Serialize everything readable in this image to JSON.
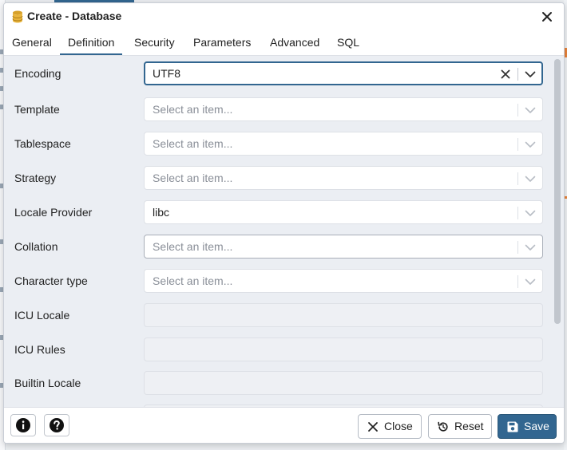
{
  "dialog": {
    "title": "Create - Database",
    "close_icon": "close-icon",
    "title_icon": "database-icon"
  },
  "tabs": [
    {
      "label": "General"
    },
    {
      "label": "Definition",
      "active": true
    },
    {
      "label": "Security"
    },
    {
      "label": "Parameters"
    },
    {
      "label": "Advanced"
    },
    {
      "label": "SQL"
    }
  ],
  "fields": {
    "encoding": {
      "label": "Encoding",
      "value": "UTF8"
    },
    "template": {
      "label": "Template",
      "placeholder": "Select an item..."
    },
    "tablespace": {
      "label": "Tablespace",
      "placeholder": "Select an item..."
    },
    "strategy": {
      "label": "Strategy",
      "placeholder": "Select an item..."
    },
    "locale_provider": {
      "label": "Locale Provider",
      "value": "libc"
    },
    "collation": {
      "label": "Collation",
      "placeholder": "Select an item..."
    },
    "character_type": {
      "label": "Character type",
      "placeholder": "Select an item..."
    },
    "icu_locale": {
      "label": "ICU Locale"
    },
    "icu_rules": {
      "label": "ICU Rules"
    },
    "builtin_locale": {
      "label": "Builtin Locale"
    }
  },
  "footer": {
    "info_icon": "info-icon",
    "help_icon": "help-icon",
    "close_label": "Close",
    "reset_label": "Reset",
    "save_label": "Save"
  },
  "colors": {
    "accent": "#326690",
    "body_bg": "#ebeef3",
    "border": "#dde0e6",
    "placeholder": "#8a8f98"
  }
}
